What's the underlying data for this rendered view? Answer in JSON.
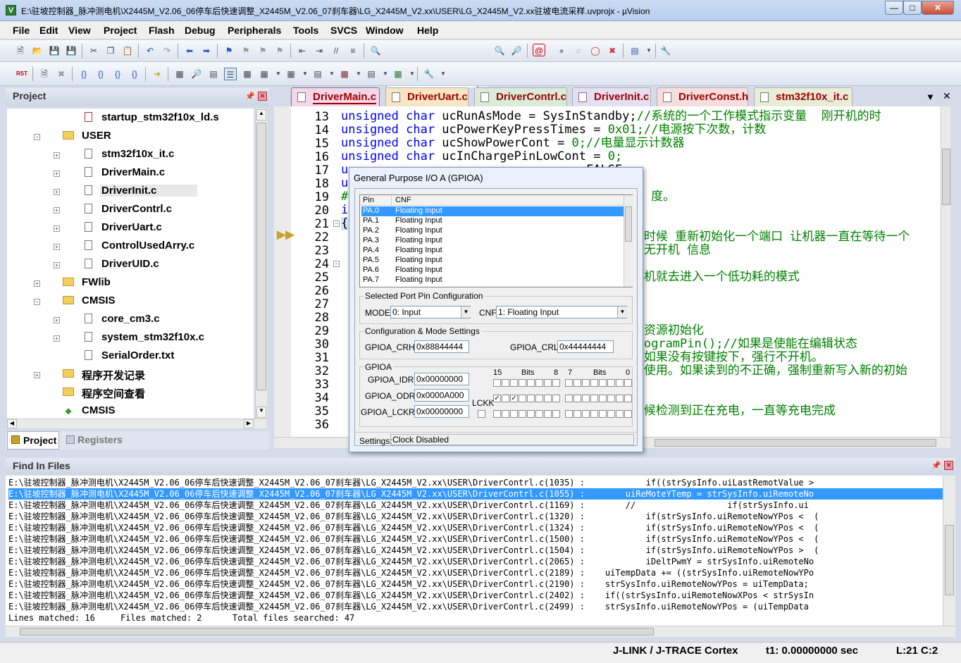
{
  "window": {
    "title": "E:\\驻坡控制器_脉冲测电机\\X2445M_V2.06_06停车后快速调整_X2445M_V2.06_07刹车器\\LG_X2445M_V2.xx\\USER\\LG_X2445M_V2.xx驻坡电流采样.uvprojx - µVision",
    "icon": "V"
  },
  "menu": [
    "File",
    "Edit",
    "View",
    "Project",
    "Flash",
    "Debug",
    "Peripherals",
    "Tools",
    "SVCS",
    "Window",
    "Help"
  ],
  "toolbar": {
    "search_value": "ucShowPowerCont",
    "rst_label": "RST"
  },
  "project_panel": {
    "title": "Project",
    "tree": [
      {
        "label": "startup_stm32f10x_ld.s",
        "kind": "asm",
        "indent": 3
      },
      {
        "label": "USER",
        "kind": "folder",
        "indent": 2,
        "expander": "−"
      },
      {
        "label": "stm32f10x_it.c",
        "kind": "file",
        "indent": 3,
        "expander": "+"
      },
      {
        "label": "DriverMain.c",
        "kind": "file",
        "indent": 3,
        "expander": "+"
      },
      {
        "label": "DriverInit.c",
        "kind": "file",
        "indent": 3,
        "expander": "+",
        "selected": true
      },
      {
        "label": "DriverContrl.c",
        "kind": "file",
        "indent": 3,
        "expander": "+"
      },
      {
        "label": "DriverUart.c",
        "kind": "file",
        "indent": 3,
        "expander": "+"
      },
      {
        "label": "ControlUsedArry.c",
        "kind": "file",
        "indent": 3,
        "expander": "+"
      },
      {
        "label": "DriverUID.c",
        "kind": "file",
        "indent": 3,
        "expander": "+"
      },
      {
        "label": "FWlib",
        "kind": "folder",
        "indent": 2,
        "expander": "+"
      },
      {
        "label": "CMSIS",
        "kind": "folder",
        "indent": 2,
        "expander": "−"
      },
      {
        "label": "core_cm3.c",
        "kind": "file",
        "indent": 3,
        "expander": "+"
      },
      {
        "label": "system_stm32f10x.c",
        "kind": "file",
        "indent": 3,
        "expander": "+"
      },
      {
        "label": "SerialOrder.txt",
        "kind": "file",
        "indent": 3
      },
      {
        "label": "程序开发记录",
        "kind": "folder",
        "indent": 2,
        "expander": "+"
      },
      {
        "label": "程序空间查看",
        "kind": "folder",
        "indent": 2
      },
      {
        "label": "CMSIS",
        "kind": "gem",
        "indent": 2
      }
    ],
    "bottom_tabs": [
      "Project",
      "Registers"
    ]
  },
  "editor": {
    "tabs": [
      {
        "label": "DriverMain.c",
        "color": "#f3d7ea",
        "active": true
      },
      {
        "label": "DriverUart.c",
        "color": "#f7e6c4"
      },
      {
        "label": "DriverContrl.c",
        "color": "#d9ecd9"
      },
      {
        "label": "DriverInit.c",
        "color": "#e6dff2"
      },
      {
        "label": "DriverConst.h",
        "color": "#f7dede"
      },
      {
        "label": "stm32f10x_it.c",
        "color": "#e8edd6"
      }
    ],
    "lines": [
      {
        "n": "13",
        "parts": [
          [
            "kw",
            "unsigned char "
          ],
          [
            "",
            "ucRunAsMode = SysInStandby;"
          ],
          [
            "cm",
            "//系统的一个工作模式指示变量  刚开机的时"
          ]
        ]
      },
      {
        "n": "14",
        "parts": [
          [
            "kw",
            "unsigned char "
          ],
          [
            "",
            "ucPowerKeyPressTimes = "
          ],
          [
            "cm",
            "0x01;//电源按下次数，计数"
          ]
        ]
      },
      {
        "n": "15",
        "parts": [
          [
            "kw",
            "unsigned char "
          ],
          [
            "",
            "ucShowPowerCont = "
          ],
          [
            "cm",
            "0;//电量显示计数器"
          ]
        ]
      },
      {
        "n": "16",
        "parts": [
          [
            "kw",
            "unsigned char "
          ],
          [
            "",
            "ucInChargePinLowCont = "
          ],
          [
            "cm",
            "0;"
          ]
        ]
      },
      {
        "n": "17",
        "parts": [
          [
            "kw",
            "u"
          ],
          [
            "",
            "                               = FALSE;"
          ]
        ]
      },
      {
        "n": "18",
        "parts": [
          [
            "kw",
            "u"
          ]
        ]
      },
      {
        "n": "19",
        "parts": [
          [
            "cm",
            "#                                          度。"
          ]
        ]
      },
      {
        "n": "20",
        "parts": [
          [
            "kw",
            "i"
          ]
        ]
      },
      {
        "n": "21",
        "parts": [
          [
            "",
            "{"
          ]
        ]
      },
      {
        "n": "22",
        "parts": [
          [
            "cm",
            "                                          时候 重新初始化一个端口 让机器一直在等待一个"
          ]
        ]
      },
      {
        "n": "23",
        "parts": [
          [
            "cm",
            "                                          无开机 信息"
          ]
        ]
      },
      {
        "n": "24",
        "parts": [
          [
            "",
            "                     "
          ]
        ]
      },
      {
        "n": "25",
        "parts": [
          [
            "cm",
            "                                          机就去进入一个低功耗的模式"
          ]
        ]
      },
      {
        "n": "26",
        "parts": [
          [
            "",
            ""
          ]
        ]
      },
      {
        "n": "27",
        "parts": [
          [
            "",
            ""
          ]
        ]
      },
      {
        "n": "28",
        "parts": [
          [
            "",
            ""
          ]
        ]
      },
      {
        "n": "29",
        "parts": [
          [
            "cm",
            "                                          资源初始化"
          ]
        ]
      },
      {
        "n": "30",
        "parts": [
          [
            "cm",
            "                                          ogramPin();//如果是使能在编辑状态"
          ]
        ]
      },
      {
        "n": "31",
        "parts": [
          [
            "cm",
            "                                          如果没有按键按下，强行不开机。"
          ]
        ]
      },
      {
        "n": "32",
        "parts": [
          [
            "cm",
            "                                          使用。如果读到的不正确，强制重新写入新的初始"
          ]
        ]
      },
      {
        "n": "33",
        "parts": [
          [
            "",
            ""
          ]
        ]
      },
      {
        "n": "34",
        "parts": [
          [
            "",
            ""
          ]
        ]
      },
      {
        "n": "35",
        "parts": [
          [
            "cm",
            "                                          候检测到正在充电，一直等充电完成"
          ]
        ]
      },
      {
        "n": "36",
        "parts": [
          [
            "",
            ""
          ]
        ]
      }
    ]
  },
  "dialog": {
    "title": "General Purpose I/O A (GPIOA)",
    "list_headers": [
      "Pin",
      "CNF"
    ],
    "pins": [
      {
        "pin": "PA.0",
        "cnf": "Floating Input"
      },
      {
        "pin": "PA.1",
        "cnf": "Floating Input"
      },
      {
        "pin": "PA.2",
        "cnf": "Floating Input"
      },
      {
        "pin": "PA.3",
        "cnf": "Floating Input"
      },
      {
        "pin": "PA.4",
        "cnf": "Floating Input"
      },
      {
        "pin": "PA.5",
        "cnf": "Floating Input"
      },
      {
        "pin": "PA.6",
        "cnf": "Floating Input"
      },
      {
        "pin": "PA.7",
        "cnf": "Floating Input"
      }
    ],
    "selected_group": "Selected Port Pin Configuration",
    "mode_label": "MODE:",
    "mode_value": "0: Input",
    "cnf_label": "CNF:",
    "cnf_value": "1: Floating Input",
    "config_group": "Configuration & Mode Settings",
    "crh_label": "GPIOA_CRH:",
    "crh_value": "0x88844444",
    "crl_label": "GPIOA_CRL:",
    "crl_value": "0x44444444",
    "gpio_group": "GPIOA",
    "idr_label": "GPIOA_IDR:",
    "idr_value": "0x00000000",
    "odr_label": "GPIOA_ODR:",
    "odr_value": "0x0000A000",
    "lckr_label": "GPIOA_LCKR:",
    "lckr_value": "0x00000000",
    "lckk_label": "LCKK",
    "bits_hi": [
      "15",
      "Bits",
      "8"
    ],
    "bits_lo": [
      "7",
      "Bits",
      "0"
    ],
    "settings_label": "Settings:",
    "settings_value": "Clock Disabled"
  },
  "find": {
    "title": "Find In Files",
    "rows": [
      {
        "path": "E:\\驻坡控制器_脉冲测电机\\X2445M_V2.06_06停车后快速调整_X2445M_V2.06_07刹车器\\LG_X2445M_V2.xx\\USER\\DriverContrl.c(1035) :",
        "code": "            if((strSysInfo.uiLastRemotValue >"
      },
      {
        "path": "E:\\驻坡控制器_脉冲测电机\\X2445M_V2.06_06停车后快速调整_X2445M_V2.06_07刹车器\\LG_X2445M_V2.xx\\USER\\DriverContrl.c(1055) :",
        "code": "        uiReMoteYTemp = strSysInfo.uiRemoteNo",
        "selected": true
      },
      {
        "path": "E:\\驻坡控制器_脉冲测电机\\X2445M_V2.06_06停车后快速调整_X2445M_V2.06_07刹车器\\LG_X2445M_V2.xx\\USER\\DriverContrl.c(1169) :",
        "code": "        //                  if(strSysInfo.ui"
      },
      {
        "path": "E:\\驻坡控制器_脉冲测电机\\X2445M_V2.06_06停车后快速调整_X2445M_V2.06_07刹车器\\LG_X2445M_V2.xx\\USER\\DriverContrl.c(1320) :",
        "code": "            if(strSysInfo.uiRemoteNowYPos <  ("
      },
      {
        "path": "E:\\驻坡控制器_脉冲测电机\\X2445M_V2.06_06停车后快速调整_X2445M_V2.06_07刹车器\\LG_X2445M_V2.xx\\USER\\DriverContrl.c(1324) :",
        "code": "            if(strSysInfo.uiRemoteNowYPos <  ("
      },
      {
        "path": "E:\\驻坡控制器_脉冲测电机\\X2445M_V2.06_06停车后快速调整_X2445M_V2.06_07刹车器\\LG_X2445M_V2.xx\\USER\\DriverContrl.c(1500) :",
        "code": "            if(strSysInfo.uiRemoteNowYPos <  ("
      },
      {
        "path": "E:\\驻坡控制器_脉冲测电机\\X2445M_V2.06_06停车后快速调整_X2445M_V2.06_07刹车器\\LG_X2445M_V2.xx\\USER\\DriverContrl.c(1504) :",
        "code": "            if(strSysInfo.uiRemoteNowYPos >  ("
      },
      {
        "path": "E:\\驻坡控制器_脉冲测电机\\X2445M_V2.06_06停车后快速调整_X2445M_V2.06_07刹车器\\LG_X2445M_V2.xx\\USER\\DriverContrl.c(2065) :",
        "code": "            iDeltPwmY = strSysInfo.uiRemoteNo"
      },
      {
        "path": "E:\\驻坡控制器_脉冲测电机\\X2445M_V2.06_06停车后快速调整_X2445M_V2.06_07刹车器\\LG_X2445M_V2.xx\\USER\\DriverContrl.c(2189) :",
        "code": "    uiTempData += ((strSysInfo.uiRemoteNowYPo"
      },
      {
        "path": "E:\\驻坡控制器_脉冲测电机\\X2445M_V2.06_06停车后快速调整_X2445M_V2.06_07刹车器\\LG_X2445M_V2.xx\\USER\\DriverContrl.c(2190) :",
        "code": "    strSysInfo.uiRemoteNowYPos = uiTempData;"
      },
      {
        "path": "E:\\驻坡控制器_脉冲测电机\\X2445M_V2.06_06停车后快速调整_X2445M_V2.06_07刹车器\\LG_X2445M_V2.xx\\USER\\DriverContrl.c(2402) :",
        "code": "    if((strSysInfo.uiRemoteNowXPos < strSysIn"
      },
      {
        "path": "E:\\驻坡控制器_脉冲测电机\\X2445M_V2.06_06停车后快速调整_X2445M_V2.06_07刹车器\\LG_X2445M_V2.xx\\USER\\DriverContrl.c(2499) :",
        "code": "    strSysInfo.uiRemoteNowYPos = (uiTempData"
      }
    ],
    "summary": "Lines matched: 16     Files matched: 2      Total files searched: 47"
  },
  "status": {
    "debugger": "J-LINK / J-TRACE Cortex",
    "time": "t1: 0.00000000 sec",
    "position": "L:21 C:2"
  },
  "colors": {
    "keyword": "#0000ff",
    "comment": "#008000",
    "selection": "#3399ff"
  }
}
